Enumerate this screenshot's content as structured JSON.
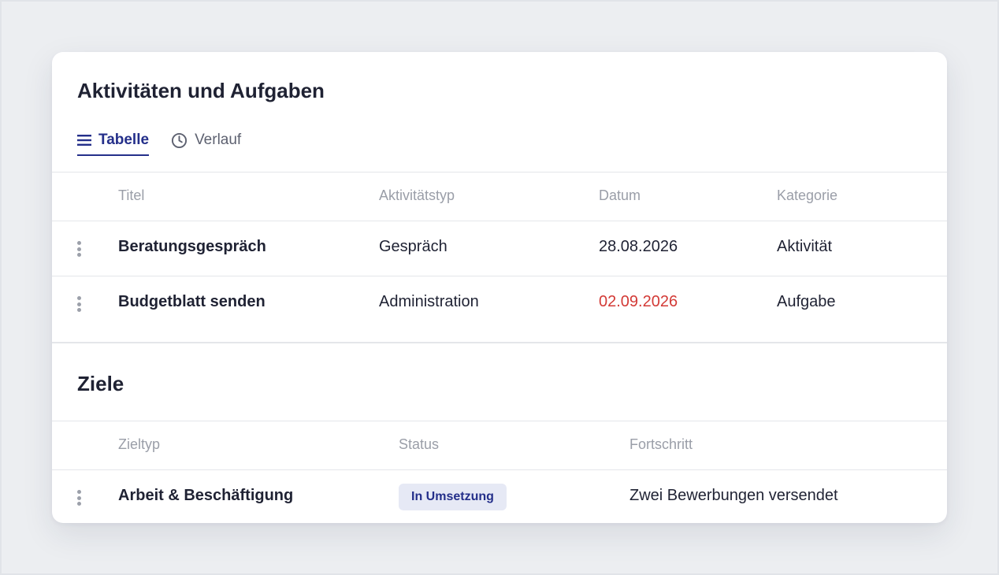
{
  "activities": {
    "title": "Aktivitäten und Aufgaben",
    "tabs": [
      {
        "label": "Tabelle",
        "icon": "list-icon",
        "active": true
      },
      {
        "label": "Verlauf",
        "icon": "clock-icon",
        "active": false
      }
    ],
    "columns": [
      "Titel",
      "Aktivitätstyp",
      "Datum",
      "Kategorie"
    ],
    "rows": [
      {
        "title": "Beratungsgespräch",
        "type": "Gespräch",
        "date": "28.08.2026",
        "category": "Aktivität",
        "overdue": false
      },
      {
        "title": "Budgetblatt senden",
        "type": "Administration",
        "date": "02.09.2026",
        "category": "Aufgabe",
        "overdue": true
      }
    ]
  },
  "goals": {
    "title": "Ziele",
    "columns": [
      "Zieltyp",
      "Status",
      "Fortschritt"
    ],
    "rows": [
      {
        "type": "Arbeit & Beschäftigung",
        "status": "In Umsetzung",
        "progress": "Zwei Bewerbungen versendet"
      }
    ]
  },
  "colors": {
    "accent": "#242f8a",
    "overdue": "#d33a36",
    "badge_bg": "#e6e9f5"
  }
}
